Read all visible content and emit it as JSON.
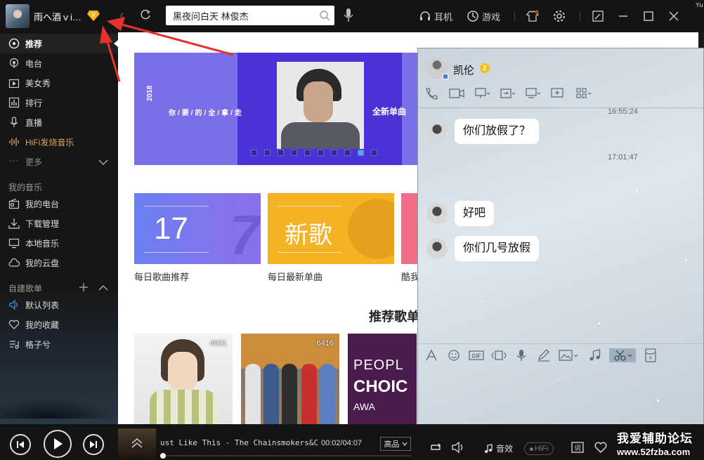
{
  "window": {
    "username": "雨へ酒ｖi…",
    "corner_tag": "Yu"
  },
  "search": {
    "value": "黑夜问白天 林俊杰"
  },
  "topbar": {
    "earphone_label": "耳机",
    "game_label": "游戏"
  },
  "sidebar": {
    "items": [
      {
        "label": "推荐",
        "icon": "disc-icon"
      },
      {
        "label": "电台",
        "icon": "radio-icon"
      },
      {
        "label": "美女秀",
        "icon": "tv-icon"
      },
      {
        "label": "排行",
        "icon": "chart-icon"
      },
      {
        "label": "直播",
        "icon": "mic-icon"
      },
      {
        "label": "HiFi发烧音乐",
        "icon": "waveform-icon"
      },
      {
        "label": "更多",
        "icon": "ellipsis-icon"
      }
    ],
    "my_music_heading": "我的音乐",
    "my_music": [
      {
        "label": "我的电台",
        "icon": "radio-box-icon"
      },
      {
        "label": "下载管理",
        "icon": "download-icon"
      },
      {
        "label": "本地音乐",
        "icon": "monitor-icon"
      },
      {
        "label": "我的云盘",
        "icon": "cloud-icon"
      }
    ],
    "playlists_heading": "自建歌单",
    "playlists": [
      {
        "label": "默认列表",
        "icon": "speaker-icon"
      },
      {
        "label": "我的收藏",
        "icon": "heart-icon"
      },
      {
        "label": "格子兮",
        "icon": "list-icon"
      }
    ]
  },
  "banner": {
    "year": "2018",
    "slogan": "你/要/的/全/拿/走",
    "tag": "全新单曲",
    "dot_count": 10,
    "active_dot": 8
  },
  "cards": [
    {
      "text": "17",
      "caption": "每日歌曲推荐"
    },
    {
      "text": "新歌",
      "caption": "每日最新单曲"
    },
    {
      "text": "",
      "caption": "酷我"
    }
  ],
  "recommend": {
    "title": "推荐歌单",
    "playlists": [
      {
        "count": "4831"
      },
      {
        "count": "6416"
      },
      {
        "count": "",
        "line1": "PEOPL",
        "line2": "CHOIC",
        "line3": "AWA"
      }
    ]
  },
  "chat": {
    "contact_name": "凯伦",
    "badge": "Z",
    "messages": [
      {
        "time": "16:55:24",
        "text": "你们放假了？"
      },
      {
        "time": "17:01:47",
        "text": "好吧"
      },
      {
        "time": "",
        "text": "你们几号放假"
      }
    ]
  },
  "player": {
    "track": "ust Like This - The Chainsmokers&Coldp",
    "elapsed": "00:02",
    "duration": "04:07",
    "quality": "高品",
    "sound_effect": "音效",
    "hifi": "HiFi",
    "progress": 0.012
  },
  "watermark": {
    "title": "我爱辅助论坛",
    "url": "www.52fzba.com"
  },
  "colors": {
    "accent": "#31c27c",
    "hifi_gold": "#d7a75b",
    "annotation_red": "#e5322d"
  }
}
